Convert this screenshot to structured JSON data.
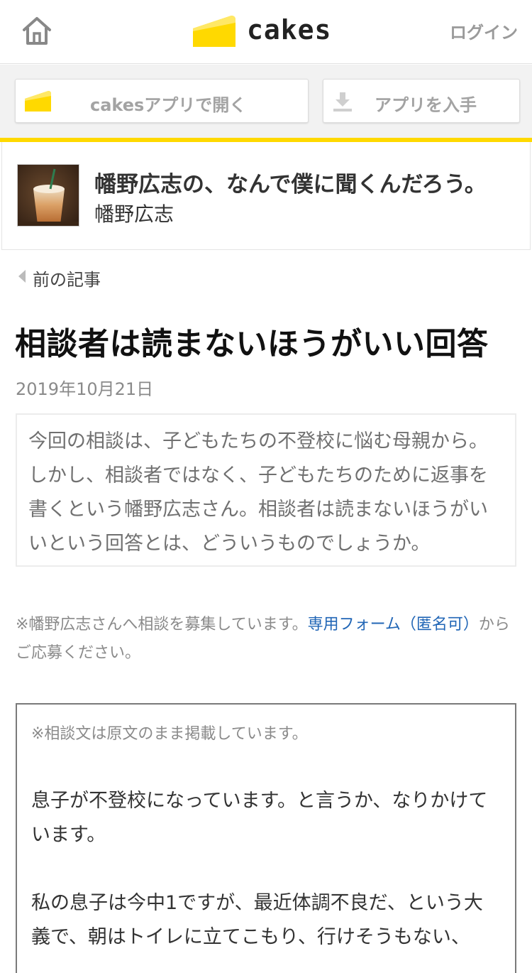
{
  "header": {
    "logo_text": "cakes",
    "login_label": "ログイン"
  },
  "app_bar": {
    "open_app_label": "cakesアプリで開く",
    "get_app_label": "アプリを入手"
  },
  "series": {
    "title": "幡野広志の、なんで僕に聞くんだろう。",
    "author": "幡野広志"
  },
  "article": {
    "prev_label": "前の記事",
    "title": "相談者は読まないほうがいい回答",
    "date": "2019年10月21日",
    "lead": "今回の相談は、子どもたちの不登校に悩む母親から。しかし、相談者ではなく、子どもたちのために返事を書くという幡野広志さん。相談者は読まないほうがいいという回答とは、どういうものでしょうか。"
  },
  "notice": {
    "prefix": "※幡野広志さんへ相談を募集しています。",
    "link_text": "専用フォーム（匿名可）",
    "suffix": "からご応募ください。"
  },
  "letter": {
    "note": "※相談文は原文のまま掲載しています。",
    "para1": "息子が不登校になっています。と言うか、なりかけています。",
    "para2": "私の息子は今中1ですが、最近体調不良だ、という大義で、朝はトイレに立てこもり、行けそうもない、"
  },
  "colors": {
    "brand_yellow": "#ffd900",
    "link_blue": "#2166b6"
  },
  "icons": {
    "home": "home-icon",
    "logo": "cake-slice-icon",
    "download": "download-icon",
    "back": "triangle-left-icon"
  }
}
